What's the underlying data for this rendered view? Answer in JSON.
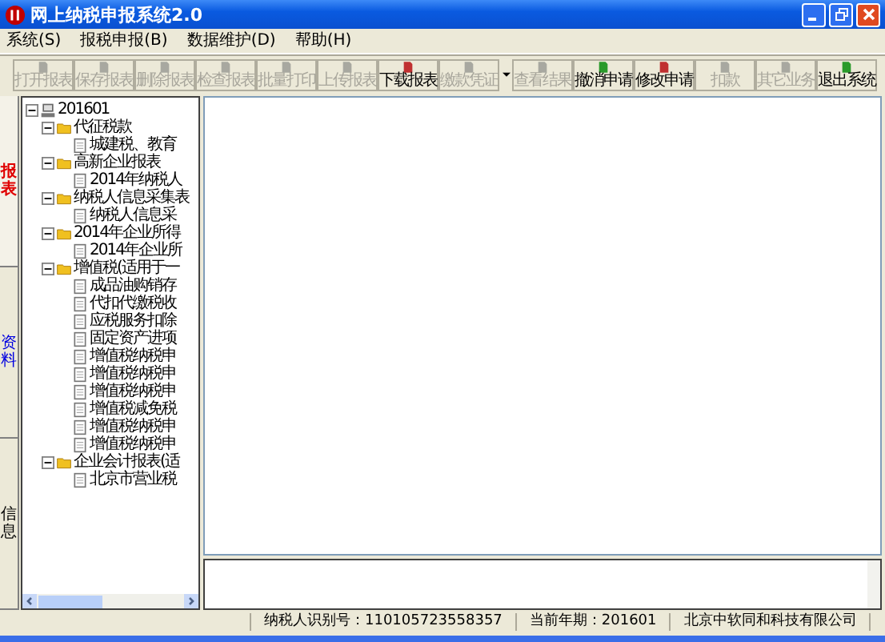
{
  "window": {
    "title": "网上纳税申报系统2.0"
  },
  "menu": [
    {
      "label": "系统(S)"
    },
    {
      "label": "报税申报(B)"
    },
    {
      "label": "数据维护(D)"
    },
    {
      "label": "帮助(H)"
    }
  ],
  "toolbar": [
    {
      "label": "打开报表",
      "disabled": true
    },
    {
      "label": "保存报表",
      "disabled": true
    },
    {
      "label": "删除报表",
      "disabled": true
    },
    {
      "label": "检查报表",
      "disabled": true
    },
    {
      "label": "批量打印",
      "disabled": true
    },
    {
      "label": "上传报表",
      "disabled": true
    },
    {
      "label": "下载报表",
      "disabled": false
    },
    {
      "label": "缴款凭证",
      "disabled": true,
      "dropdown": true
    },
    {
      "label": "查看结果",
      "disabled": true
    },
    {
      "label": "撤消申请",
      "disabled": false
    },
    {
      "label": "修改申请",
      "disabled": false
    },
    {
      "label": "扣款",
      "disabled": true
    },
    {
      "label": "其它业务",
      "disabled": true
    },
    {
      "label": "退出系统",
      "disabled": false
    }
  ],
  "side_tabs": [
    {
      "label": "报表",
      "selected": true,
      "color": "#e00000"
    },
    {
      "label": "资料",
      "selected": false,
      "color": "#0000e0"
    },
    {
      "label": "信息",
      "selected": false,
      "color": "#000000"
    }
  ],
  "tree": {
    "label": "201601",
    "expanded": true,
    "children": [
      {
        "label": "代征税款",
        "expanded": true,
        "children": [
          {
            "label": "城建税、教育"
          }
        ]
      },
      {
        "label": "高新企业报表",
        "expanded": true,
        "children": [
          {
            "label": "2014年纳税人"
          }
        ]
      },
      {
        "label": "纳税人信息采集表",
        "expanded": true,
        "children": [
          {
            "label": "纳税人信息采"
          }
        ]
      },
      {
        "label": "2014年企业所得",
        "expanded": true,
        "children": [
          {
            "label": "2014年企业所"
          }
        ]
      },
      {
        "label": "增值税(适用于一",
        "expanded": true,
        "children": [
          {
            "label": "成品油购销存"
          },
          {
            "label": "代扣代缴税收"
          },
          {
            "label": "应税服务扣除"
          },
          {
            "label": "固定资产进项"
          },
          {
            "label": "增值税纳税申"
          },
          {
            "label": "增值税纳税申"
          },
          {
            "label": "增值税纳税申"
          },
          {
            "label": "增值税减免税"
          },
          {
            "label": "增值税纳税申"
          },
          {
            "label": "增值税纳税申"
          }
        ]
      },
      {
        "label": "企业会计报表(适",
        "expanded": true,
        "children": [
          {
            "label": "北京市营业税"
          }
        ]
      }
    ]
  },
  "status_bar": [
    {
      "label": "纳税人识别号：110105723558357"
    },
    {
      "label": "当前年期：201601"
    },
    {
      "label": "北京中软同和科技有限公司"
    }
  ]
}
